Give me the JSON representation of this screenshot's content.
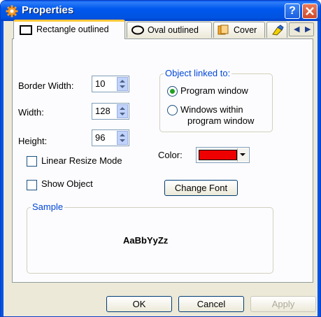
{
  "window": {
    "title": "Properties"
  },
  "tabs": [
    {
      "label": "Rectangle outlined",
      "icon": "rectangle-icon",
      "active": true
    },
    {
      "label": "Oval outlined",
      "icon": "oval-icon",
      "active": false
    },
    {
      "label": "Cover",
      "icon": "cover-icon",
      "active": false
    },
    {
      "label": "",
      "icon": "highlighter-icon",
      "active": false
    }
  ],
  "fields": {
    "border_width": {
      "label": "Border Width:",
      "value": "10"
    },
    "width": {
      "label": "Width:",
      "value": "128"
    },
    "height": {
      "label": "Height:",
      "value": "96"
    }
  },
  "checkboxes": {
    "linear_resize": {
      "label": "Linear Resize Mode",
      "checked": false
    },
    "show_object": {
      "label": "Show Object",
      "checked": false
    }
  },
  "linked_group": {
    "title": "Object linked to:",
    "option1": "Program window",
    "option2_line1": "Windows within",
    "option2_line2": "program window",
    "selected": "Program window"
  },
  "color": {
    "label": "Color:",
    "value": "#ee0000"
  },
  "change_font_label": "Change Font",
  "sample": {
    "title": "Sample",
    "text": "AaBbYyZz"
  },
  "footer": {
    "ok": "OK",
    "cancel": "Cancel",
    "apply": "Apply"
  },
  "colors": {
    "title_bar": "#0054e3",
    "accent_tab": "#ffc83c",
    "group_title": "#0046d5"
  }
}
